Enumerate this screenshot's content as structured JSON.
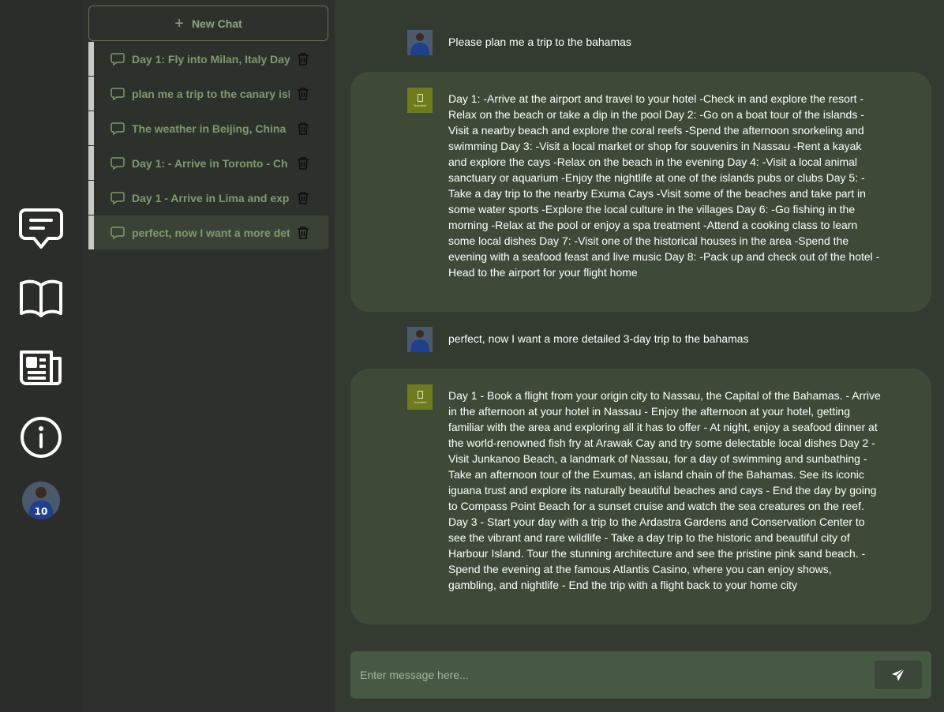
{
  "sidebar": {
    "new_chat_label": "New Chat",
    "chats": [
      {
        "title": "Day 1: Fly into Milan, Italy Day"
      },
      {
        "title": "plan me a trip to the canary islands"
      },
      {
        "title": "The weather in Beijing, China"
      },
      {
        "title": "Day 1: - Arrive in Toronto - Ch"
      },
      {
        "title": "Day 1 - Arrive in Lima and exp"
      },
      {
        "title": "perfect, now I want a more detailed"
      }
    ]
  },
  "rail": {
    "icons": [
      "chat-icon",
      "book-icon",
      "news-icon",
      "info-icon"
    ],
    "avatar_number": "10"
  },
  "conversation": {
    "messages": [
      {
        "role": "user",
        "text": "Please plan me a trip to the bahamas"
      },
      {
        "role": "assistant",
        "text": "Day 1: -Arrive at the airport and travel to your hotel -Check in and explore the resort -Relax on the beach or take a dip in the pool Day 2: -Go on a boat tour of the islands -Visit a nearby beach and explore the coral reefs -Spend the afternoon snorkeling and swimming Day 3: -Visit a local market or shop for souvenirs in Nassau -Rent a kayak and explore the cays -Relax on the beach in the evening Day 4: -Visit a local animal sanctuary or aquarium -Enjoy the nightlife at one of the islands pubs or clubs Day 5: -Take a day trip to the nearby Exuma Cays -Visit some of the beaches and take part in some water sports -Explore the local culture in the villages Day 6: -Go fishing in the morning -Relax at the pool or enjoy a spa treatment -Attend a cooking class to learn some local dishes Day 7: -Visit one of the historical houses in the area -Spend the evening with a seafood feast and live music Day 8: -Pack up and check out of the hotel -Head to the airport for your flight home"
      },
      {
        "role": "user",
        "text": "perfect, now I want a more detailed 3-day trip to the bahamas"
      },
      {
        "role": "assistant",
        "text": "Day 1 - Book a flight from your origin city to Nassau, the Capital of the Bahamas. - Arrive in the afternoon at your hotel in Nassau - Enjoy the afternoon at your hotel, getting familiar with the area and exploring all it has to offer - At night, enjoy a seafood dinner at the world-renowned fish fry at Arawak Cay and try some delectable local dishes Day 2 - Visit Junkanoo Beach, a landmark of Nassau, for a day of swimming and sunbathing - Take an afternoon tour of the Exumas, an island chain of the Bahamas. See its iconic iguana trust and explore its naturally beautiful beaches and cays - End the day by going to Compass Point Beach for a sunset cruise and watch the sea creatures on the reef. Day 3 - Start your day with a trip to the Ardastra Gardens and Conservation Center to see the vibrant and rare wildlife - Take a day trip to the historic and beautiful city of Harbour Island. Tour the stunning architecture and see the pristine pink sand beach. - Spend the evening at the famous Atlantis Casino, where you can enjoy shows, gambling, and nightlife - End the trip with a flight back to your home city"
      }
    ],
    "bot_logo_text": "Travelbot"
  },
  "composer": {
    "placeholder": "Enter message here...",
    "value": ""
  },
  "colors": {
    "rail_bg": "#2a2d29",
    "sidebar_bg": "#2d312c",
    "main_bg": "#333a30",
    "bot_bubble": "#3e4a37",
    "composer_bg": "#465942",
    "accent_text": "#7f9a6c"
  }
}
